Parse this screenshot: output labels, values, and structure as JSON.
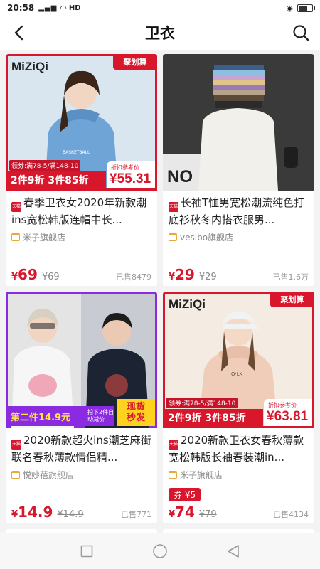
{
  "status_bar": {
    "time": "20:58",
    "network": "HD"
  },
  "header": {
    "title": "卫衣"
  },
  "products": [
    {
      "brand": "MiZiQi",
      "campaign": "聚划算",
      "coupon": "领券:满78-5/满148-10",
      "deal": "2件9折 3件85折",
      "discount_label": "折扣参考价",
      "discount_price": "¥55.31",
      "title": "春季卫衣女2020年新款潮ins宽松韩版连帽中长...",
      "store": "米子旗舰店",
      "currency": "¥",
      "price": "69",
      "original_price": "¥69",
      "sold": "已售8479",
      "colors": {
        "bg": "#7fb0d9",
        "garment": "#6fa4d6"
      }
    },
    {
      "title": "长袖T恤男宽松潮流纯色打底衫秋冬内搭衣服男...",
      "store": "vesibo旗舰店",
      "currency": "¥",
      "price": "29",
      "original_price": "¥29",
      "sold": "已售1.6万",
      "colors": {
        "bg": "#2c2c2c",
        "garment": "#f2f0ea"
      }
    },
    {
      "banner": "第二件14.9元",
      "banner_sub": "拍下2件自动减价",
      "badge": "现货秒发",
      "title": "2020新款超火ins潮芝麻街联名春秋薄款情侣精...",
      "store": "悦妙蓓旗舰店",
      "currency": "¥",
      "price": "14.9",
      "original_price": "¥14.9",
      "sold": "已售771",
      "colors": {
        "bg": "#dcdcdc",
        "garment_left": "#f6f6f6",
        "garment_right": "#1c2433"
      }
    },
    {
      "brand": "MiZiQi",
      "campaign": "聚划算",
      "coupon": "领券:满78-5/满148-10",
      "deal": "2件9折 3件85折",
      "discount_label": "折扣参考价",
      "discount_price": "¥63.81",
      "title": "2020新款卫衣女春秋薄款宽松韩版长袖春装潮in...",
      "store": "米子旗舰店",
      "coupon_tag": "券 ¥5",
      "currency": "¥",
      "price": "74",
      "original_price": "¥79",
      "sold": "已售4134",
      "colors": {
        "bg": "#f4ebe3",
        "garment": "#f0cdb8"
      }
    }
  ],
  "tmall_badge": "天猫"
}
